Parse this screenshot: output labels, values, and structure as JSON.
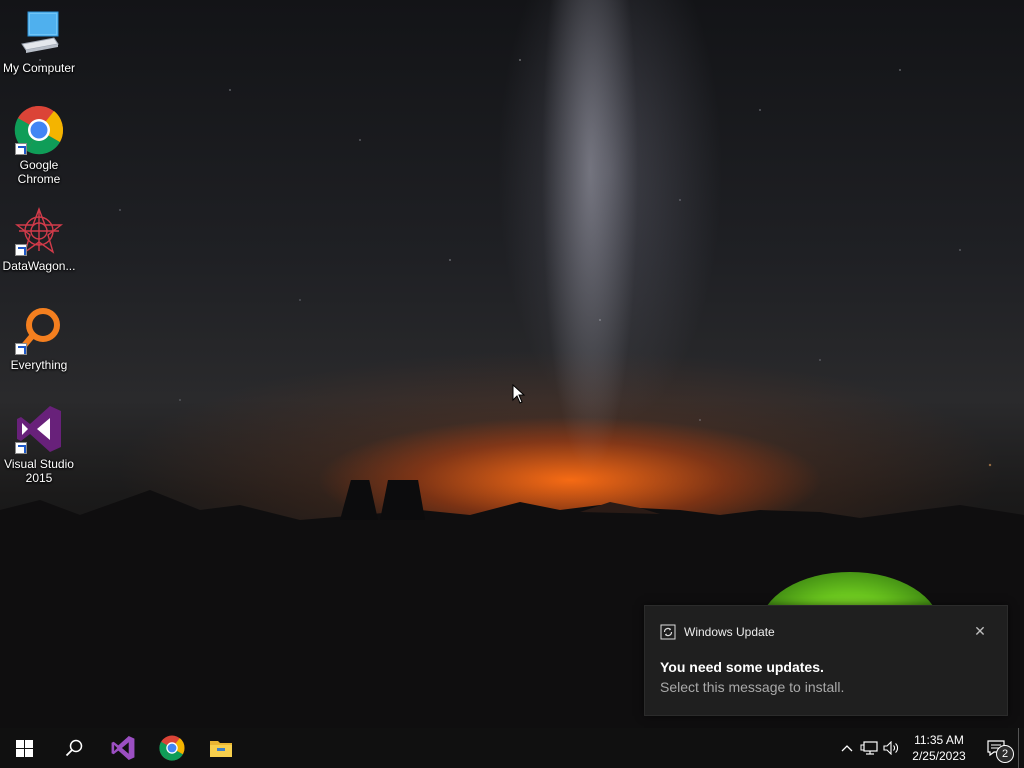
{
  "desktop": {
    "wallpaper": "Milky Way over mountain silhouette with glowing tent",
    "colors": {
      "horizon_glow": "#ff6e14",
      "tent": "#7ddb25",
      "sky": "#1f2024"
    },
    "icons": [
      {
        "label": "My Computer",
        "icon": "computer-icon"
      },
      {
        "label": "Google Chrome",
        "icon": "chrome-icon"
      },
      {
        "label": "DataWagon...",
        "icon": "datawagon-icon"
      },
      {
        "label": "Everything",
        "icon": "everything-search-icon"
      },
      {
        "label": "Visual Studio 2015",
        "icon": "visual-studio-icon"
      }
    ]
  },
  "toast": {
    "app_name": "Windows Update",
    "app_icon": "windows-update-icon",
    "title": "You need some updates.",
    "body": "Select this message to install.",
    "close_icon": "close-icon"
  },
  "taskbar": {
    "start_icon": "windows-start-icon",
    "search_icon": "search-icon",
    "pinned": [
      "visual-studio-icon",
      "chrome-icon",
      "file-explorer-icon"
    ],
    "tray": {
      "chevron": "^",
      "network_icon": "network-icon",
      "volume_icon": "volume-icon",
      "time": "11:35 AM",
      "date": "2/25/2023",
      "notification_count": "2"
    }
  }
}
